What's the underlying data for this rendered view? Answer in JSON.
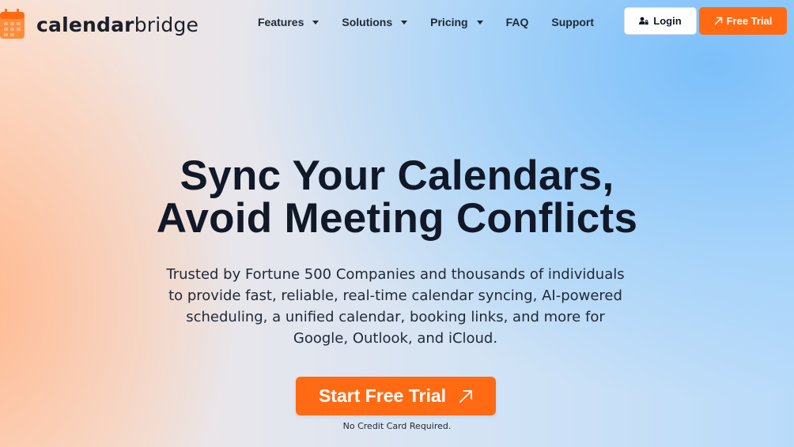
{
  "brand": {
    "name_bold": "calendar",
    "name_regular": "bridge",
    "accent": "#ff6a13",
    "icon": "calendar-grid-icon"
  },
  "nav": {
    "items": [
      {
        "label": "Features",
        "has_dropdown": true
      },
      {
        "label": "Solutions",
        "has_dropdown": true
      },
      {
        "label": "Pricing",
        "has_dropdown": true
      },
      {
        "label": "FAQ",
        "has_dropdown": false
      },
      {
        "label": "Support",
        "has_dropdown": false
      }
    ],
    "login_label": "Login",
    "login_icon": "user-lock-icon",
    "trial_label": "Free Trial",
    "trial_icon": "arrow-up-right-icon"
  },
  "hero": {
    "title_line1": "Sync Your Calendars,",
    "title_line2": "Avoid Meeting Conflicts",
    "subtitle": "Trusted by Fortune 500 Companies and thousands of individuals to provide fast, reliable, real-time calendar syncing, AI-powered scheduling, a unified calendar, booking links, and more for Google, Outlook, and iCloud.",
    "cta_label": "Start Free Trial",
    "cta_icon": "arrow-up-right-icon",
    "cta_note": "No Credit Card Required."
  }
}
